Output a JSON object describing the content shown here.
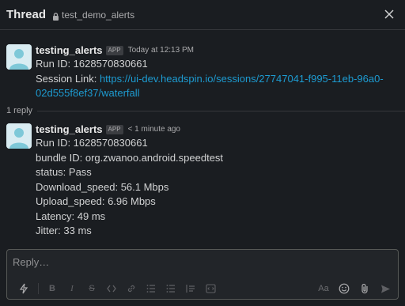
{
  "header": {
    "title": "Thread",
    "channel": "test_demo_alerts"
  },
  "messages": [
    {
      "author": "testing_alerts",
      "badge": "APP",
      "time": "Today at 12:13 PM",
      "run_id": "Run ID: 1628570830661",
      "session_prefix": "Session Link: ",
      "session_link_line1": "https://ui-dev.headspin.io/sessions/27747041-f995-11eb-96a0-",
      "session_link_line2": "02d555f8ef37/waterfall"
    },
    {
      "author": "testing_alerts",
      "badge": "APP",
      "time": "< 1 minute ago",
      "lines": [
        "Run ID: 1628570830661",
        "bundle ID: org.zwanoo.android.speedtest",
        "status: Pass",
        "Download_speed: 56.1 Mbps",
        "Upload_speed: 6.96 Mbps",
        "Latency: 49 ms",
        "Jitter: 33 ms"
      ]
    }
  ],
  "replies": {
    "label": "1 reply"
  },
  "composer": {
    "placeholder": "Reply…",
    "format_text_label": "Aa"
  },
  "colors": {
    "background": "#1a1d21",
    "link": "#1d9bd1",
    "avatar": "#d9ecf2"
  }
}
